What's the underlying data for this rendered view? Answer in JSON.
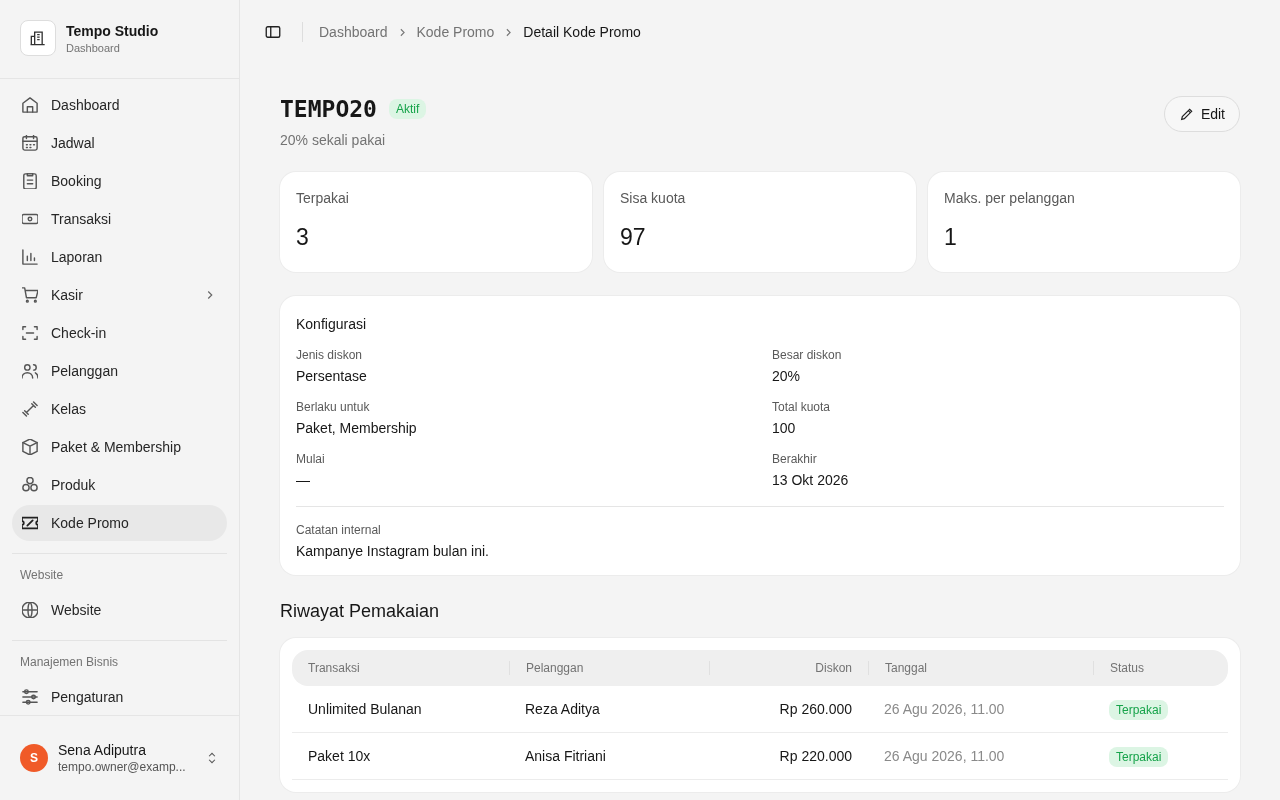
{
  "sidebar": {
    "brand": {
      "name": "Tempo Studio",
      "subtitle": "Dashboard"
    },
    "groups": [
      {
        "items": [
          {
            "label": "Dashboard",
            "selected": false,
            "submenu": false
          },
          {
            "label": "Jadwal",
            "selected": false,
            "submenu": false
          },
          {
            "label": "Booking",
            "selected": false,
            "submenu": false
          },
          {
            "label": "Transaksi",
            "selected": false,
            "submenu": false
          },
          {
            "label": "Laporan",
            "selected": false,
            "submenu": false
          },
          {
            "label": "Kasir",
            "selected": false,
            "submenu": true
          },
          {
            "label": "Check-in",
            "selected": false,
            "submenu": false
          },
          {
            "label": "Pelanggan",
            "selected": false,
            "submenu": false
          },
          {
            "label": "Kelas",
            "selected": false,
            "submenu": false
          },
          {
            "label": "Paket & Membership",
            "selected": false,
            "submenu": false
          },
          {
            "label": "Produk",
            "selected": false,
            "submenu": false
          },
          {
            "label": "Kode Promo",
            "selected": true,
            "submenu": false
          }
        ]
      },
      {
        "heading": "Website",
        "items": [
          {
            "label": "Website",
            "selected": false,
            "submenu": false
          }
        ]
      },
      {
        "heading": "Manajemen Bisnis",
        "items": [
          {
            "label": "Pengaturan",
            "selected": false,
            "submenu": false
          }
        ]
      }
    ],
    "user": {
      "initial": "S",
      "name": "Sena Adiputra",
      "email": "tempo.owner@examp..."
    }
  },
  "breadcrumb": [
    {
      "label": "Dashboard",
      "current": false
    },
    {
      "label": "Kode Promo",
      "current": false
    },
    {
      "label": "Detail Kode Promo",
      "current": true
    }
  ],
  "header": {
    "code": "TEMPO20",
    "status": "Aktif",
    "active": true,
    "subtitle": "20% sekali pakai",
    "edit_button": "Edit"
  },
  "stats": [
    {
      "label": "Terpakai",
      "value": "3"
    },
    {
      "label": "Sisa kuota",
      "value": "97"
    },
    {
      "label": "Maks. per pelanggan",
      "value": "1"
    }
  ],
  "configuration": {
    "title": "Konfigurasi",
    "fields": [
      {
        "label": "Jenis diskon",
        "value": "Persentase"
      },
      {
        "label": "Besar diskon",
        "value": "20%"
      },
      {
        "label": "Berlaku untuk",
        "value": "Paket, Membership"
      },
      {
        "label": "Total kuota",
        "value": "100"
      },
      {
        "label": "Mulai",
        "value": "—"
      },
      {
        "label": "Berakhir",
        "value": "13 Okt 2026"
      }
    ],
    "note": {
      "label": "Catatan internal",
      "value": "Kampanye Instagram bulan ini."
    }
  },
  "usage": {
    "title": "Riwayat Pemakaian",
    "columns": [
      "Transaksi",
      "Pelanggan",
      "Diskon",
      "Tanggal",
      "Status"
    ],
    "rows": [
      {
        "transaksi": "Unlimited Bulanan",
        "pelanggan": "Reza Aditya",
        "diskon": "Rp 260.000",
        "tanggal": "26 Agu 2026, 11.00",
        "status": "Terpakai"
      },
      {
        "transaksi": "Paket 10x",
        "pelanggan": "Anisa Fitriani",
        "diskon": "Rp 220.000",
        "tanggal": "26 Agu 2026, 11.00",
        "status": "Terpakai"
      }
    ]
  }
}
